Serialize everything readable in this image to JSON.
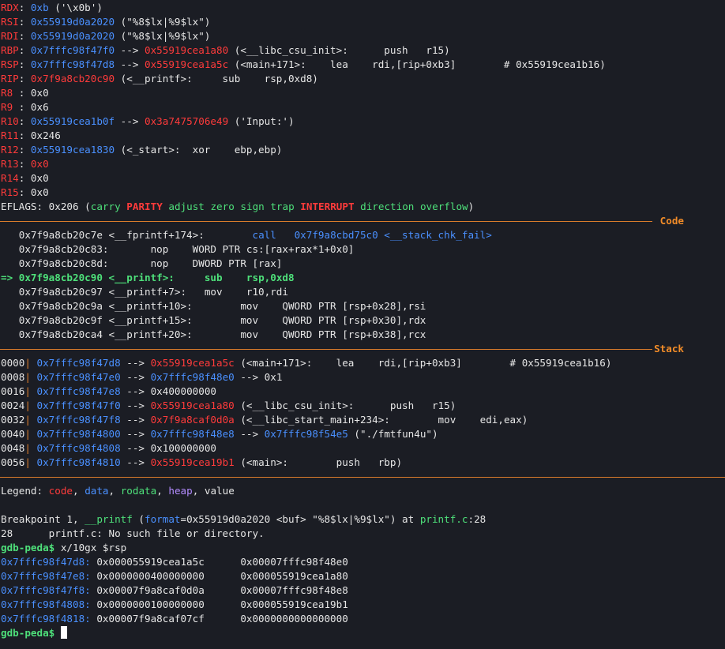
{
  "registers": [
    {
      "name": "RDX",
      "val": "0xb",
      "rest": " ('\\x0b')"
    },
    {
      "name": "RSI",
      "val": "0x55919d0a2020",
      "rest": " (\"%8$lx|%9$lx\")"
    },
    {
      "name": "RDI",
      "val": "0x55919d0a2020",
      "rest": " (\"%8$lx|%9$lx\")"
    },
    {
      "name": "RBP",
      "val": "0x7fffc98f47f0",
      "arrow": " --> ",
      "val2": "0x55919cea1a80",
      "rest": " (<__libc_csu_init>:      push   r15)"
    },
    {
      "name": "RSP",
      "val": "0x7fffc98f47d8",
      "arrow": " --> ",
      "val2": "0x55919cea1a5c",
      "rest": " (<main+171>:    lea    rdi,[rip+0xb3]        # 0x55919cea1b16)"
    },
    {
      "name": "RIP",
      "val": "0x7f9a8cb20c90",
      "rest": " (<__printf>:     sub    rsp,0xd8)"
    },
    {
      "name": "R8 ",
      "val": "0x0",
      "plain": true
    },
    {
      "name": "R9 ",
      "val": "0x6",
      "plain": true
    },
    {
      "name": "R10",
      "val": "0x55919cea1b0f",
      "arrow": " --> ",
      "val2": "0x3a7475706e49",
      "rest": " ('Input:')"
    },
    {
      "name": "R11",
      "val": "0x246",
      "plain": true
    },
    {
      "name": "R12",
      "val": "0x55919cea1830",
      "rest": " (<_start>:  xor    ebp,ebp)"
    },
    {
      "name": "R13",
      "val": "0x0",
      "plain": true
    },
    {
      "name": "R14",
      "val": "0x0",
      "plain": true
    },
    {
      "name": "R15",
      "val": "0x0",
      "plain": true
    }
  ],
  "eflags": {
    "label": "EFLAGS",
    "val": "0x206",
    "open": " (",
    "flags": [
      {
        "t": "carry",
        "set": false
      },
      {
        "t": "PARITY",
        "set": true
      },
      {
        "t": "adjust",
        "set": false
      },
      {
        "t": "zero",
        "set": false
      },
      {
        "t": "sign",
        "set": false
      },
      {
        "t": "trap",
        "set": false
      },
      {
        "t": "INTERRUPT",
        "set": true
      },
      {
        "t": "direction",
        "set": false
      },
      {
        "t": "overflow",
        "set": false
      }
    ],
    "close": ")"
  },
  "code_title": "Code",
  "code": [
    {
      "addr": "0x7f9a8cb20c7e",
      "sym": " <__fprintf+174>:",
      "gap": "        ",
      "op": "call",
      "args": "   0x7f9a8cbd75c0 <__stack_chk_fail>",
      "current": false
    },
    {
      "addr": "0x7f9a8cb20c83",
      "sym": ":",
      "gap": "       ",
      "op": "nop",
      "args": "    WORD PTR cs:[rax+rax*1+0x0]",
      "current": false
    },
    {
      "addr": "0x7f9a8cb20c8d",
      "sym": ":",
      "gap": "       ",
      "op": "nop",
      "args": "    DWORD PTR [rax]",
      "current": false
    },
    {
      "addr": "0x7f9a8cb20c90",
      "sym": " <__printf>:",
      "gap": "     ",
      "op": "sub",
      "args": "    rsp,0xd8",
      "current": true,
      "marker": "=> "
    },
    {
      "addr": "0x7f9a8cb20c97",
      "sym": " <__printf+7>:",
      "gap": "   ",
      "op": "mov",
      "args": "    r10,rdi",
      "current": false
    },
    {
      "addr": "0x7f9a8cb20c9a",
      "sym": " <__printf+10>:",
      "gap": "        ",
      "op": "mov",
      "args": "    QWORD PTR [rsp+0x28],rsi",
      "current": false
    },
    {
      "addr": "0x7f9a8cb20c9f",
      "sym": " <__printf+15>:",
      "gap": "        ",
      "op": "mov",
      "args": "    QWORD PTR [rsp+0x30],rdx",
      "current": false
    },
    {
      "addr": "0x7f9a8cb20ca4",
      "sym": " <__printf+20>:",
      "gap": "        ",
      "op": "mov",
      "args": "    QWORD PTR [rsp+0x38],rcx",
      "current": false
    }
  ],
  "stack_title": "Stack",
  "stack": [
    {
      "off": "0000",
      "a": "0x7fffc98f47d8",
      "b": "0x55919cea1a5c",
      "bcol": "red",
      "rest": " (<main+171>:    lea    rdi,[rip+0xb3]        # 0x55919cea1b16)"
    },
    {
      "off": "0008",
      "a": "0x7fffc98f47e0",
      "b": "0x7fffc98f48e0",
      "bcol": "blue",
      "rest": " --> 0x1"
    },
    {
      "off": "0016",
      "a": "0x7fffc98f47e8",
      "b": "0x400000000",
      "bcol": "white",
      "rest": ""
    },
    {
      "off": "0024",
      "a": "0x7fffc98f47f0",
      "b": "0x55919cea1a80",
      "bcol": "red",
      "rest": " (<__libc_csu_init>:      push   r15)"
    },
    {
      "off": "0032",
      "a": "0x7fffc98f47f8",
      "b": "0x7f9a8caf0d0a",
      "bcol": "red",
      "rest": " (<__libc_start_main+234>:        mov    edi,eax)"
    },
    {
      "off": "0040",
      "a": "0x7fffc98f4800",
      "b": "0x7fffc98f48e8",
      "bcol": "blue",
      "rest2a": " --> ",
      "rest2b": "0x7fffc98f54e5",
      "rest2c": " (\"./fmtfun4u\")"
    },
    {
      "off": "0048",
      "a": "0x7fffc98f4808",
      "b": "0x100000000",
      "bcol": "white",
      "rest": ""
    },
    {
      "off": "0056",
      "a": "0x7fffc98f4810",
      "b": "0x55919cea19b1",
      "bcol": "red",
      "rest": " (<main>:        push   rbp)"
    }
  ],
  "legend": {
    "label": "Legend: ",
    "code": "code",
    "data": "data",
    "rodata": "rodata",
    "heap": "heap",
    "value": "value",
    "comma": ", "
  },
  "bp": {
    "pre": "Breakpoint 1, ",
    "func": "__printf",
    "open": " (",
    "argname": "format",
    "argval": "=0x55919d0a2020 <buf> \"%8$lx|%9$lx\")",
    "at": " at ",
    "file": "printf.c",
    "line": ":28"
  },
  "srcline": "28\tprintf.c: No such file or directory.",
  "prompt": "gdb-peda$",
  "cmd": " x/10gx $rsp",
  "dump": [
    {
      "addr": "0x7fffc98f47d8:",
      "v1": "0x000055919cea1a5c",
      "v2": "0x00007fffc98f48e0"
    },
    {
      "addr": "0x7fffc98f47e8:",
      "v1": "0x0000000400000000",
      "v2": "0x000055919cea1a80"
    },
    {
      "addr": "0x7fffc98f47f8:",
      "v1": "0x00007f9a8caf0d0a",
      "v2": "0x00007fffc98f48e8"
    },
    {
      "addr": "0x7fffc98f4808:",
      "v1": "0x0000000100000000",
      "v2": "0x000055919cea19b1"
    },
    {
      "addr": "0x7fffc98f4818:",
      "v1": "0x00007f9a8caf07cf",
      "v2": "0x0000000000000000"
    }
  ]
}
